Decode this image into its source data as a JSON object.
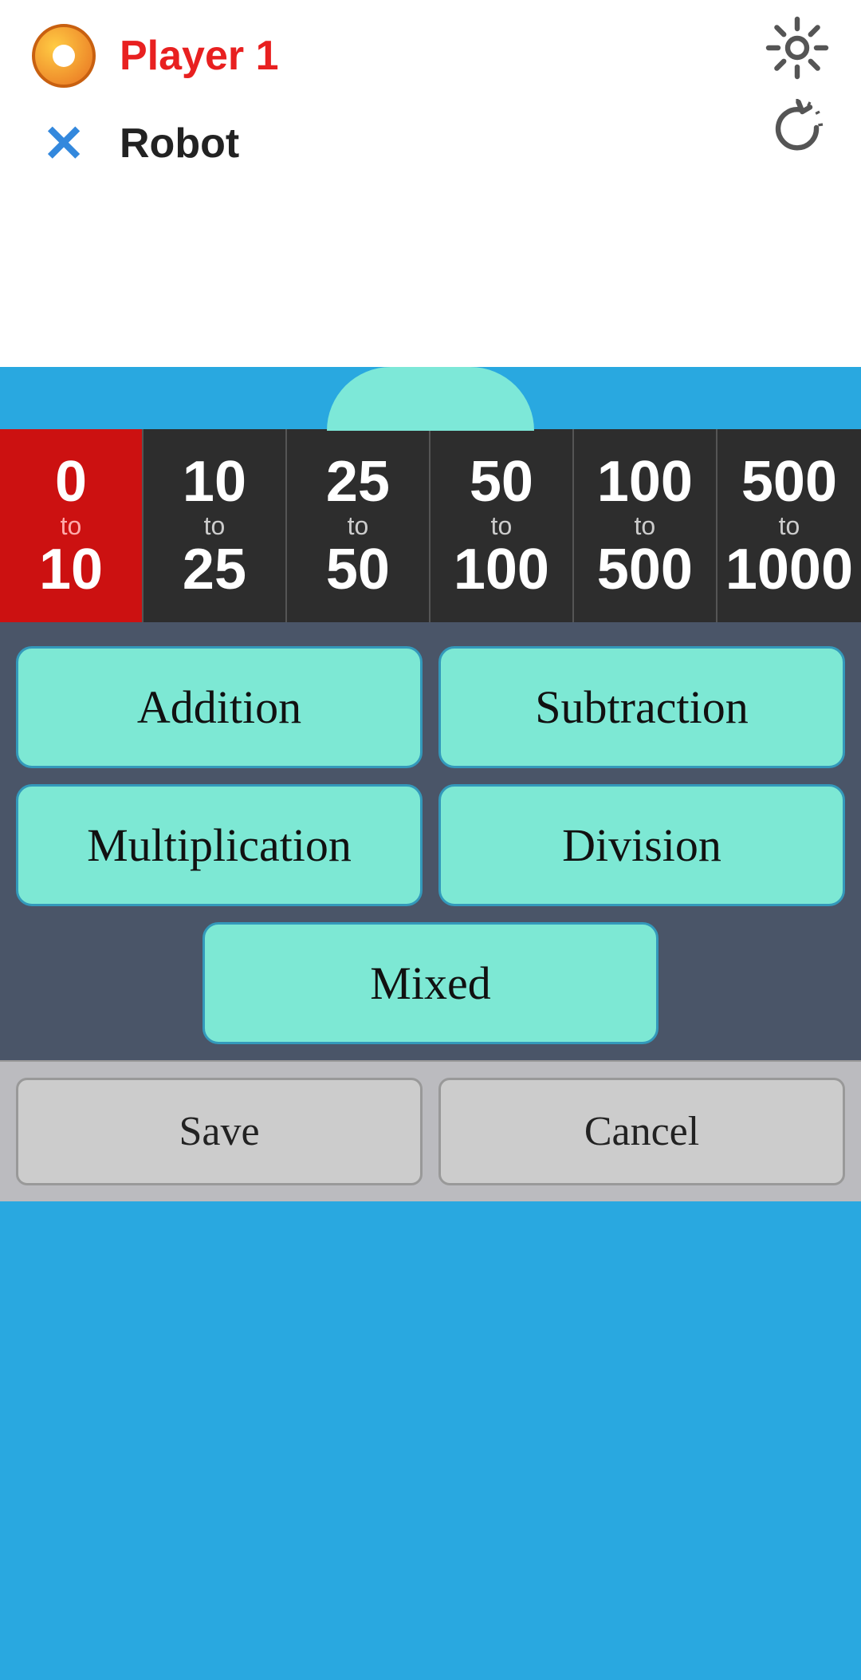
{
  "header": {
    "player1": {
      "name": "Player 1",
      "nameColor": "red"
    },
    "player2": {
      "name": "Robot",
      "nameColor": "black"
    },
    "settingsIcon": "gear-icon",
    "refreshIcon": "refresh-icon"
  },
  "rangeSelector": {
    "items": [
      {
        "id": "0to10",
        "top": "0",
        "middle": "to",
        "bottom": "10",
        "selected": true
      },
      {
        "id": "10to25",
        "top": "10",
        "middle": "to",
        "bottom": "25",
        "selected": false
      },
      {
        "id": "25to50",
        "top": "25",
        "middle": "to",
        "bottom": "50",
        "selected": false
      },
      {
        "id": "50to100",
        "top": "50",
        "middle": "to",
        "bottom": "100",
        "selected": false
      },
      {
        "id": "100to500",
        "top": "100",
        "middle": "to",
        "bottom": "500",
        "selected": false
      },
      {
        "id": "500to1000",
        "top": "500",
        "middle": "to",
        "bottom": "1000",
        "selected": false
      }
    ]
  },
  "operations": {
    "row1": [
      {
        "id": "addition",
        "label": "Addition"
      },
      {
        "id": "subtraction",
        "label": "Subtraction"
      }
    ],
    "row2": [
      {
        "id": "multiplication",
        "label": "Multiplication"
      },
      {
        "id": "division",
        "label": "Division"
      }
    ],
    "row3": [
      {
        "id": "mixed",
        "label": "Mixed"
      }
    ]
  },
  "actions": {
    "save": "Save",
    "cancel": "Cancel"
  }
}
